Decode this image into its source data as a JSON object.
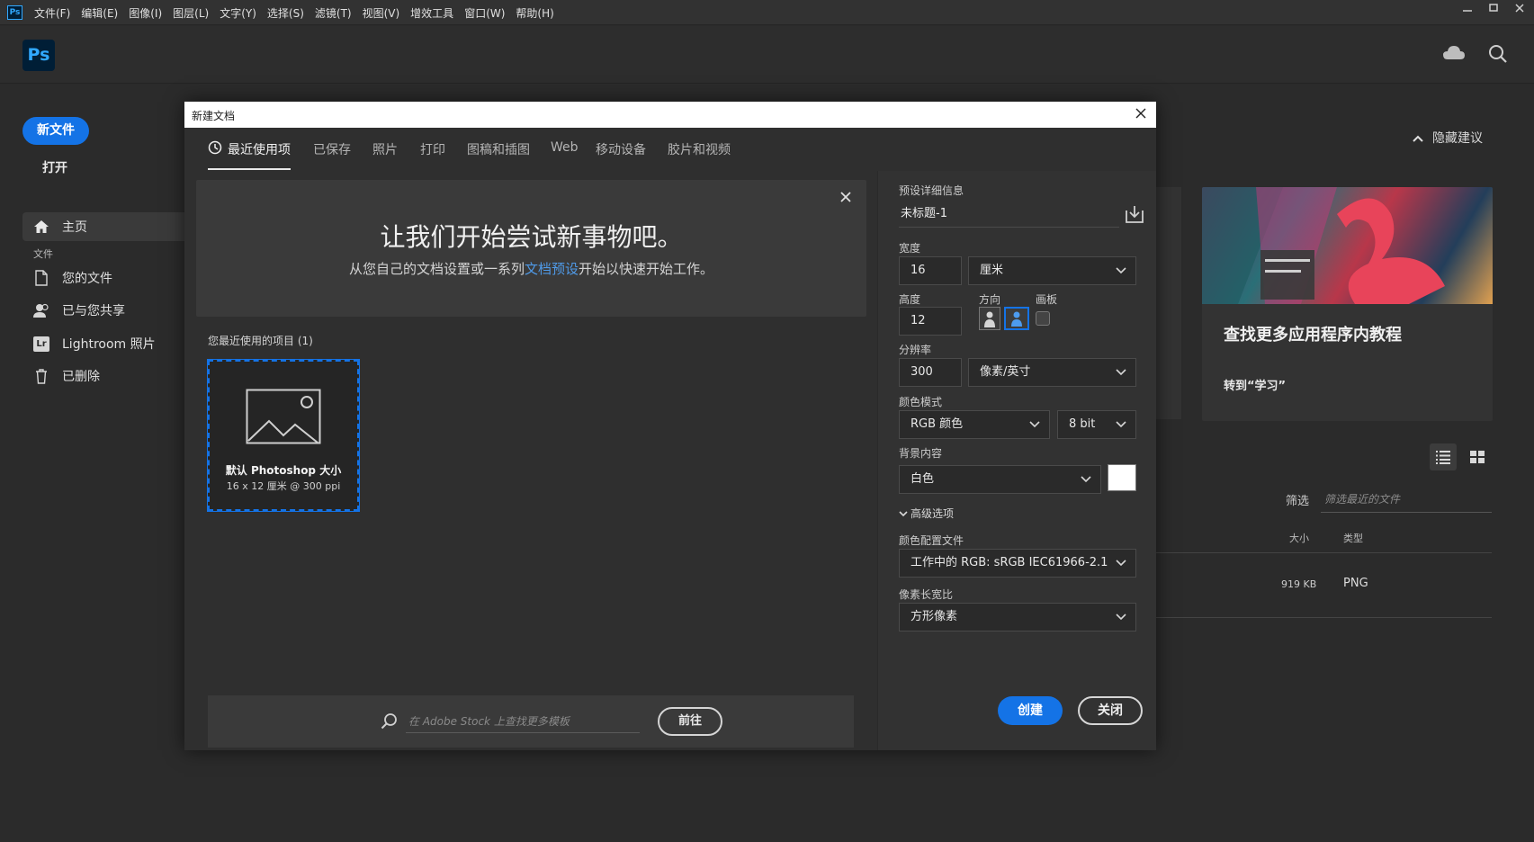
{
  "menubar": {
    "app_icon": "Ps",
    "items": [
      "文件(F)",
      "编辑(E)",
      "图像(I)",
      "图层(L)",
      "文字(Y)",
      "选择(S)",
      "滤镜(T)",
      "视图(V)",
      "增效工具",
      "窗口(W)",
      "帮助(H)"
    ]
  },
  "header": {
    "logo": "Ps"
  },
  "nav": {
    "new_file": "新文件",
    "open": "打开",
    "home": "主页",
    "section_file": "文件",
    "your_files": "您的文件",
    "shared": "已与您共享",
    "lightroom": "Lightroom 照片",
    "lightroom_badge": "Lr",
    "deleted": "已删除"
  },
  "home": {
    "hide_suggestions": "隐藏建议",
    "tutorial_title": "查找更多应用程序内教程",
    "tutorial_link": "转到“学习”",
    "filter_label": "筛选",
    "filter_placeholder": "筛选最近的文件",
    "col_size": "大小",
    "col_type": "类型",
    "row_size": "919 KB",
    "row_type": "PNG"
  },
  "dialog": {
    "title": "新建文档",
    "tabs": [
      "最近使用项",
      "已保存",
      "照片",
      "打印",
      "图稿和插图",
      "Web",
      "移动设备",
      "胶片和视频"
    ],
    "welcome_title": "让我们开始尝试新事物吧。",
    "welcome_sub_before": "从您自己的文档设置或一系列",
    "welcome_sub_link": "文档预设",
    "welcome_sub_after": "开始以快速开始工作。",
    "recent_label": "您最近使用的项目 (1)",
    "recent_item_name": "默认 Photoshop 大小",
    "recent_item_meta": "16 x 12 厘米 @ 300 ppi",
    "stock_placeholder": "在 Adobe Stock 上查找更多模板",
    "stock_go": "前往",
    "preset": {
      "section_label": "预设详细信息",
      "name": "未标题-1",
      "width_label": "宽度",
      "width_value": "16",
      "width_unit": "厘米",
      "height_label": "高度",
      "height_value": "12",
      "orientation_label": "方向",
      "artboard_label": "画板",
      "resolution_label": "分辨率",
      "resolution_value": "300",
      "resolution_unit": "像素/英寸",
      "color_mode_label": "颜色模式",
      "color_mode_value": "RGB 颜色",
      "bit_depth": "8 bit",
      "bg_label": "背景内容",
      "bg_value": "白色",
      "bg_swatch_color": "#ffffff",
      "advanced": "高级选项",
      "profile_label": "颜色配置文件",
      "profile_value": "工作中的 RGB: sRGB IEC61966-2.1",
      "pixel_ratio_label": "像素长宽比",
      "pixel_ratio_value": "方形像素"
    },
    "create": "创建",
    "close": "关闭"
  },
  "colors": {
    "accent": "#1473e6",
    "link": "#4f9ae8"
  }
}
